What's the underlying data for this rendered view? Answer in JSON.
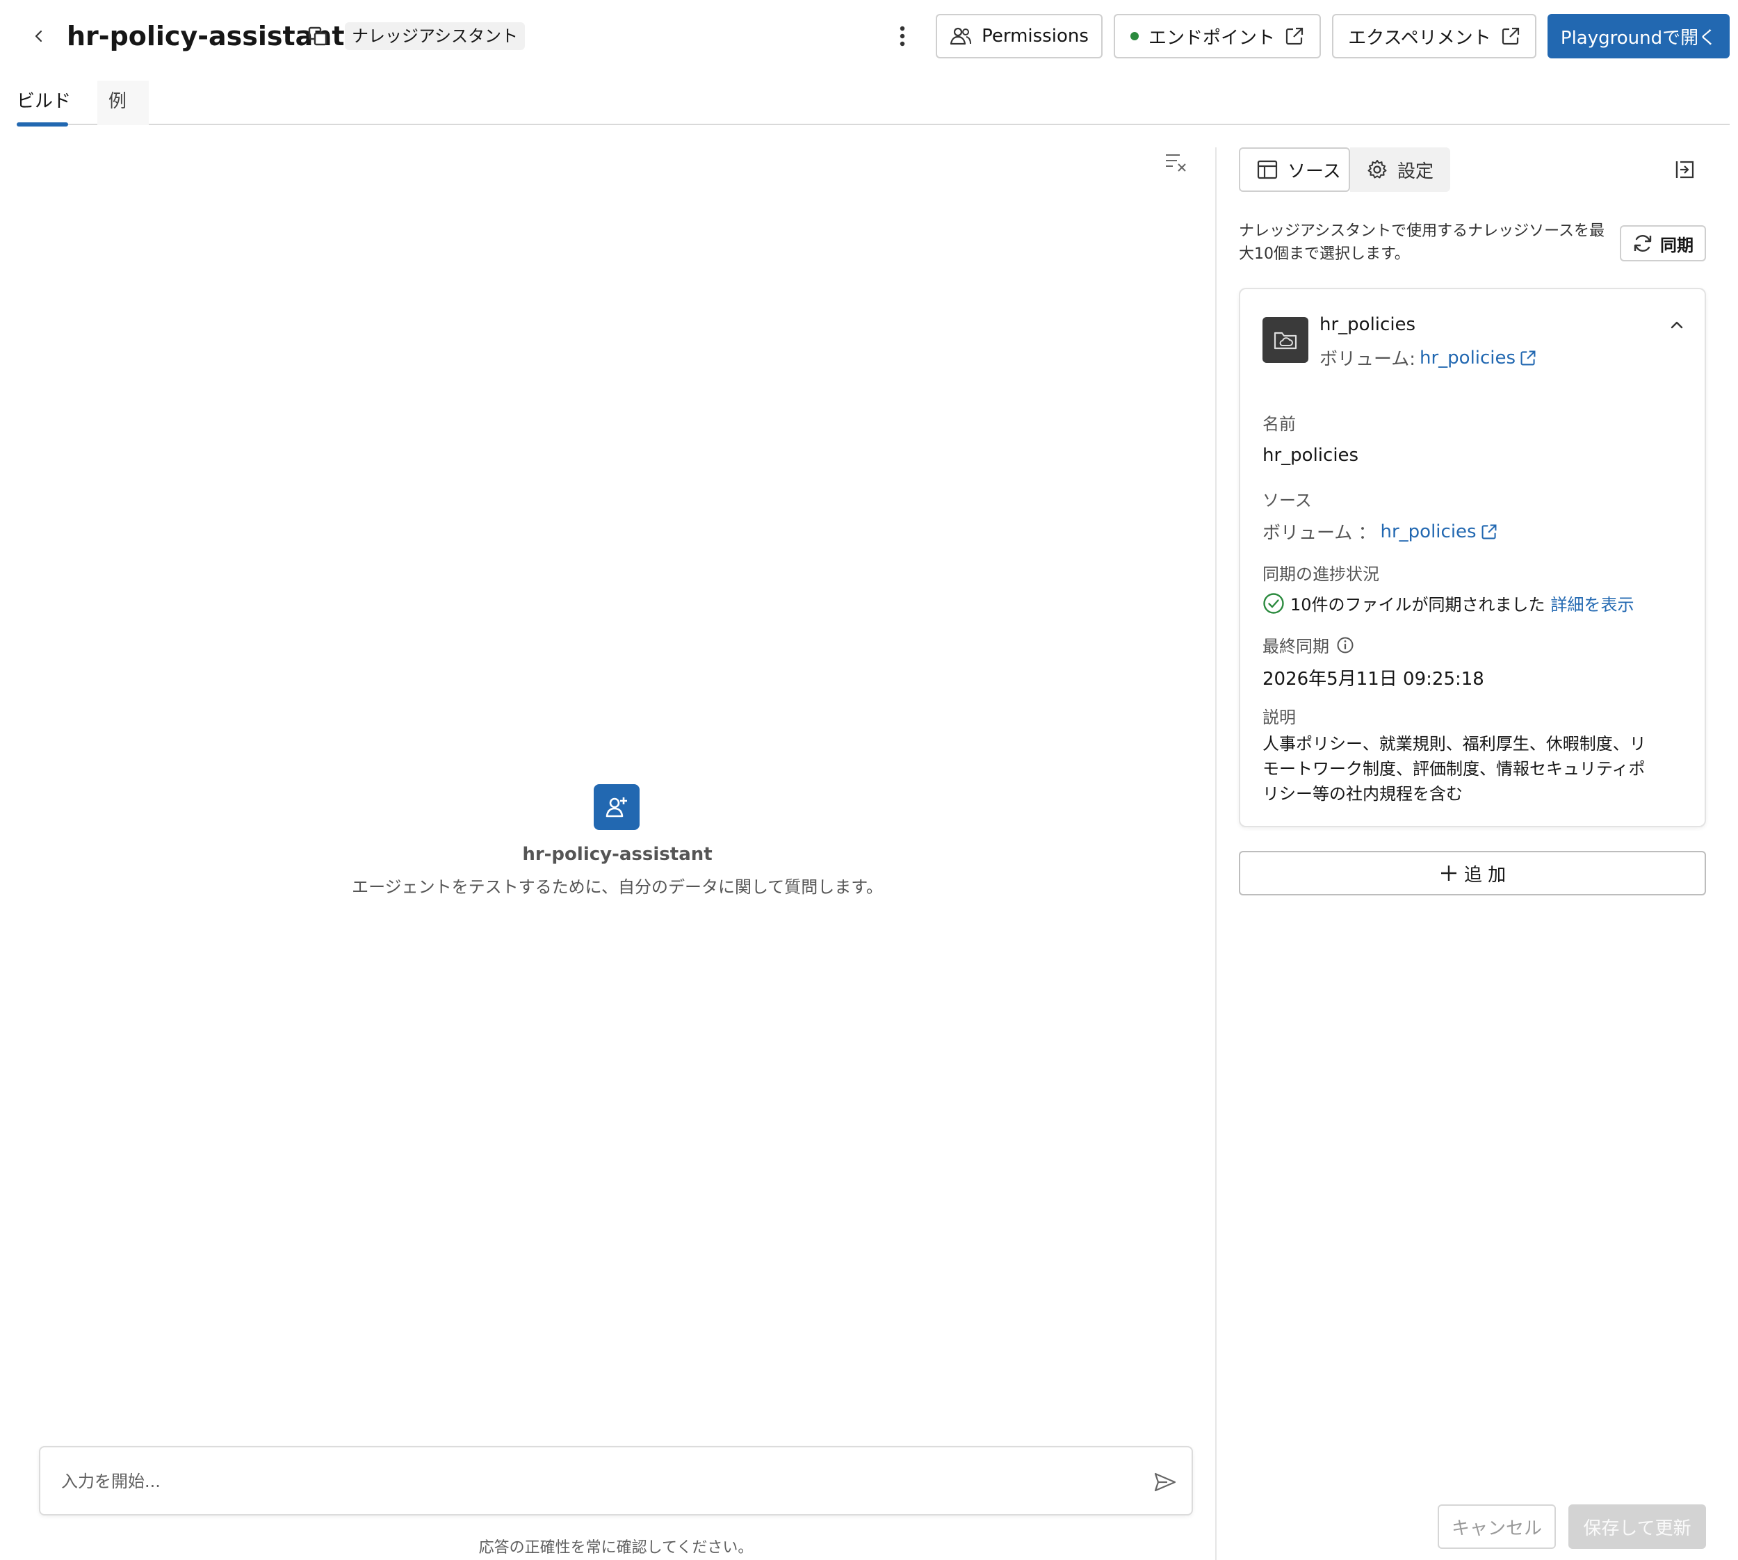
{
  "header": {
    "title": "hr-policy-assistant",
    "badge": "ナレッジアシスタント",
    "permissions_label": "Permissions",
    "endpoint_label": "エンドポイント",
    "experiment_label": "エクスペリメント",
    "playground_label": "Playgroundで開く",
    "endpoint_status_color": "#2b8a3e",
    "primary_color": "#2268b1"
  },
  "tabs": [
    {
      "label": "ビルド",
      "active": true
    },
    {
      "label": "例",
      "active": false
    }
  ],
  "chat": {
    "agent_name": "hr-policy-assistant",
    "agent_description": "エージェントをテストするために、自分のデータに関して質問します。",
    "input_placeholder": "入力を開始...",
    "disclaimer": "応答の正確性を常に確認してください。"
  },
  "config": {
    "tabs": [
      {
        "label": "ソース",
        "active": true,
        "icon": "table-icon"
      },
      {
        "label": "設定",
        "active": false,
        "icon": "gear-icon"
      }
    ],
    "sources_hint": "ナレッジアシスタントで使用するナレッジソースを最大10個まで選択します。",
    "sync_label": "同期",
    "source": {
      "title": "hr_policies",
      "subtitle_prefix": "ボリューム: ",
      "subtitle_link": "hr_policies",
      "name_label": "名前",
      "name_value": "hr_policies",
      "source_label": "ソース",
      "source_prefix": "ボリューム ： ",
      "source_link": "hr_policies",
      "sync_progress_label": "同期の進捗状況",
      "sync_progress_value": "10件のファイルが同期されました",
      "sync_details_link": "詳細を表示",
      "last_sync_label": "最終同期",
      "last_sync_value": "2026年5月11日 09:25:18",
      "description_label": "説明",
      "description_value": "人事ポリシー、就業規則、福利厚生、休暇制度、リモートワーク制度、評価制度、情報セキュリティポリシー等の社内規程を含む"
    },
    "add_label": "追 加",
    "cancel_label": "キャンセル",
    "save_label": "保存して更新"
  }
}
